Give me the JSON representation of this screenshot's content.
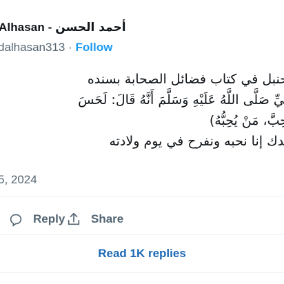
{
  "author": {
    "name_latin": "Alhasan - ",
    "name_arabic": "أحمد الحسن",
    "handle": "dalhasan313",
    "separator": " · ",
    "follow_label": "Follow"
  },
  "tweet": {
    "lines": [
      "حنبل في كتاب فضائل الصحابة بسنده",
      "بِيِّ صَلَّى اللَّهُ عَلَيْهِ وَسَلَّمَ أَنَّهُ قَالَ: لَحَسَ",
      "حِبَّ، مَنْ يُحِبُّهُ)",
      "ندك إنا نحبه ونفرح في يوم ولادته"
    ],
    "timestamp": "5, 2024"
  },
  "actions": {
    "reply_label": "Reply",
    "share_label": "Share"
  },
  "replies": {
    "label": "Read 1K replies"
  },
  "colors": {
    "accent": "#1d9bf0",
    "link": "#1d69b5",
    "muted": "#536471",
    "text": "#0f1419",
    "divider": "#eff3f4"
  }
}
